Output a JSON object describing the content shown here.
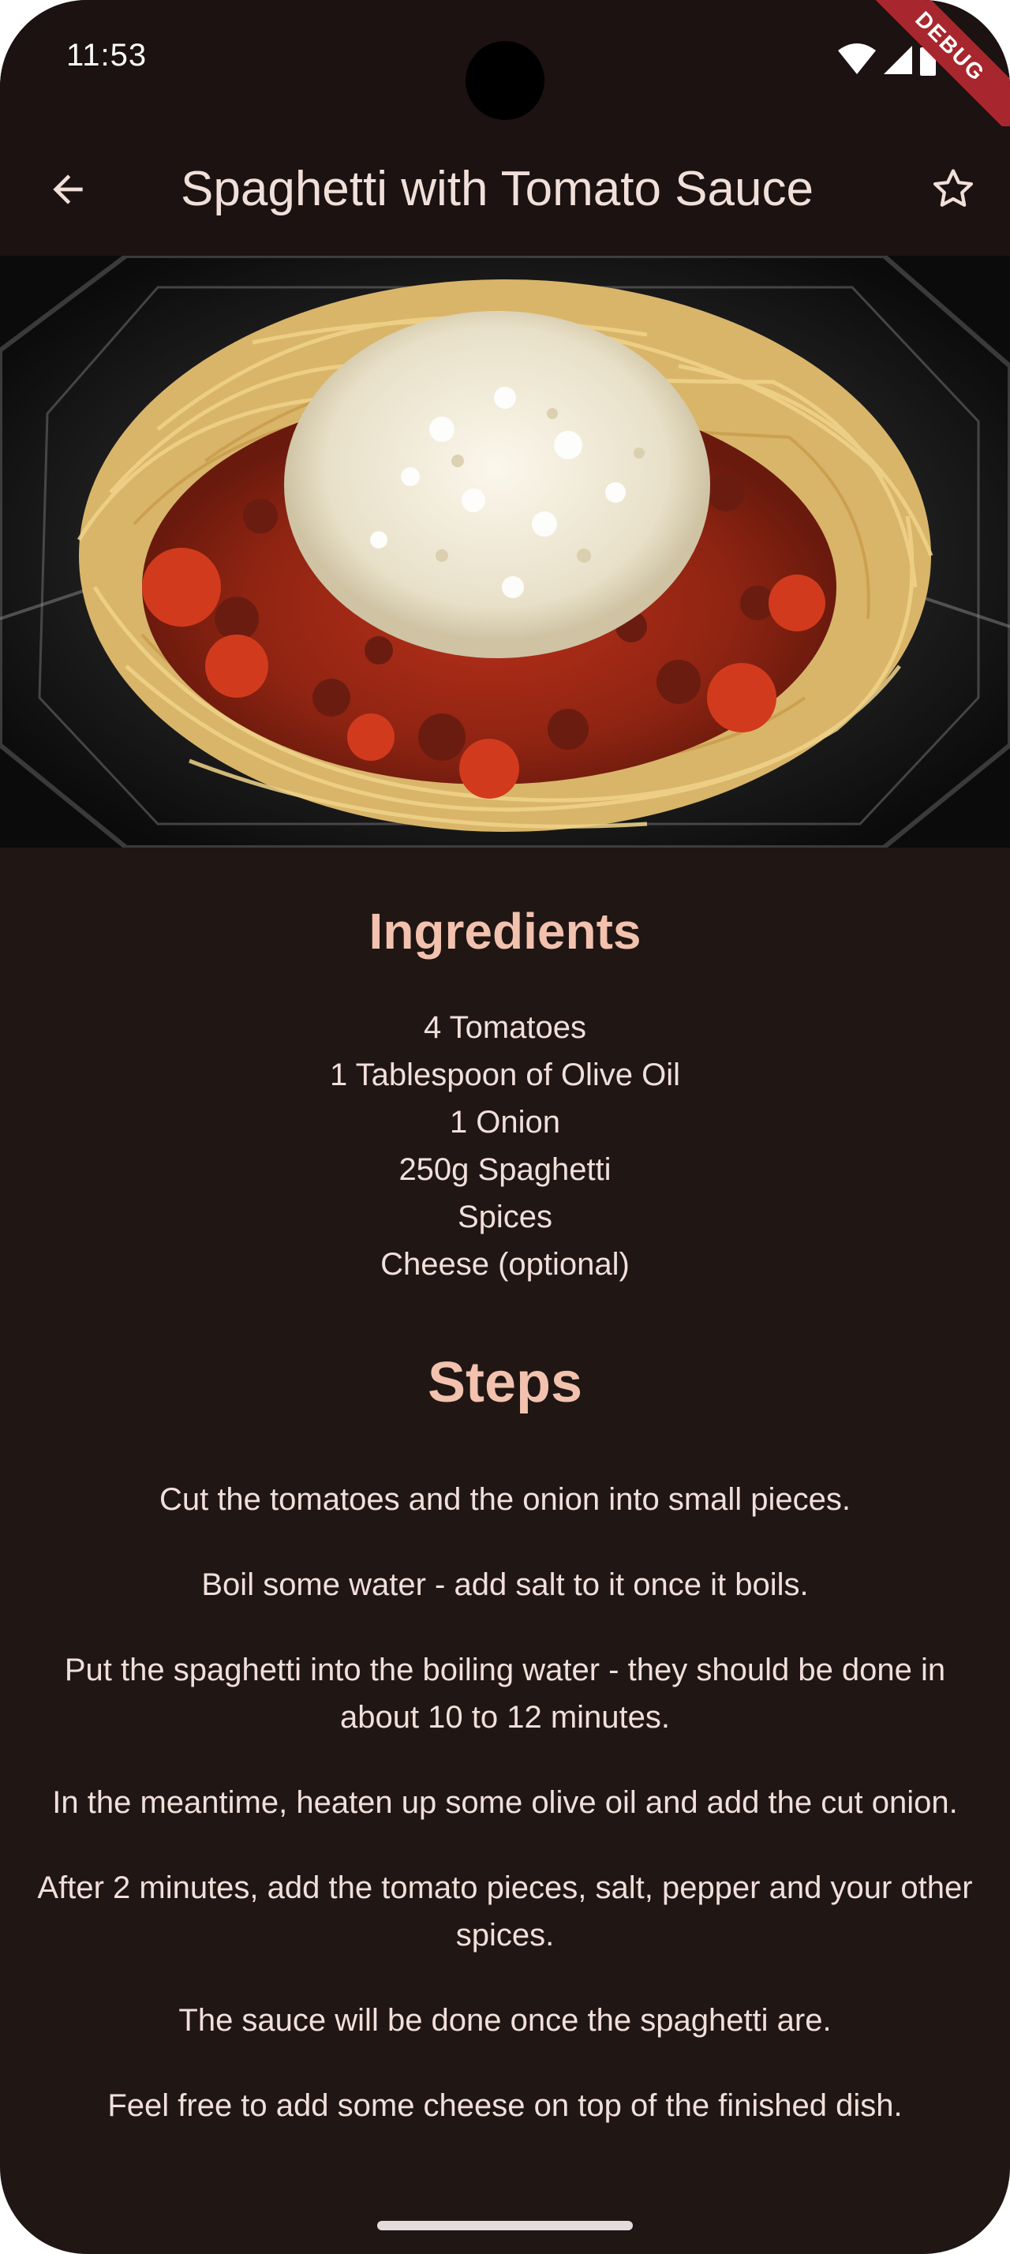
{
  "status_bar": {
    "time": "11:53",
    "debug_label": "DEBUG",
    "icons": [
      "wifi-icon",
      "signal-icon",
      "battery-icon"
    ]
  },
  "app_bar": {
    "title": "Spaghetti with Tomato Sauce",
    "back_icon": "arrow-left-icon",
    "favorite_icon": "star-outline-icon"
  },
  "ingredients": {
    "heading": "Ingredients",
    "items": [
      "4 Tomatoes",
      "1 Tablespoon of Olive Oil",
      "1 Onion",
      "250g Spaghetti",
      "Spices",
      "Cheese (optional)"
    ]
  },
  "steps": {
    "heading": "Steps",
    "items": [
      "Cut the tomatoes and the onion into small pieces.",
      "Boil some water - add salt to it once it boils.",
      "Put the spaghetti into the boiling water - they should be done in about 10 to 12 minutes.",
      "In the meantime, heaten up some olive oil and add the cut onion.",
      "After 2 minutes, add the tomato pieces, salt, pepper and your other spices.",
      "The sauce will be done once the spaghetti are.",
      "Feel free to add some cheese on top of the finished dish."
    ]
  },
  "colors": {
    "background": "#201614",
    "app_bar": "#1b1211",
    "heading": "#f2c2ae",
    "text": "#f1dfda",
    "debug_banner": "#a8262d"
  }
}
